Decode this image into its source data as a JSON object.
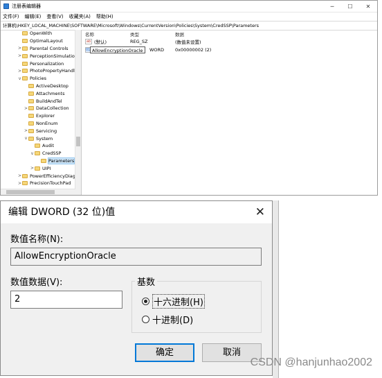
{
  "regedit": {
    "title": "注册表编辑器",
    "window_buttons": [
      "─",
      "☐",
      "✕"
    ],
    "menu": [
      "文件(F)",
      "编辑(E)",
      "查看(V)",
      "收藏夹(A)",
      "帮助(H)"
    ],
    "address": "计算机\\HKEY_LOCAL_MACHINE\\SOFTWARE\\Microsoft\\Windows\\CurrentVersion\\Policies\\System\\CredSSP\\Parameters",
    "tree": [
      {
        "label": "OpenWith",
        "depth": 0,
        "expander": ""
      },
      {
        "label": "OptimalLayout",
        "depth": 0,
        "expander": ""
      },
      {
        "label": "Parental Controls",
        "depth": 0,
        "expander": ">"
      },
      {
        "label": "PerceptionSimulatio",
        "depth": 0,
        "expander": ">"
      },
      {
        "label": "Personalization",
        "depth": 0,
        "expander": ""
      },
      {
        "label": "PhotoPropertyHandl",
        "depth": 0,
        "expander": ">"
      },
      {
        "label": "Policies",
        "depth": 0,
        "expander": "v"
      },
      {
        "label": "ActiveDesktop",
        "depth": 1,
        "expander": ""
      },
      {
        "label": "Attachments",
        "depth": 1,
        "expander": ""
      },
      {
        "label": "BuildAndTel",
        "depth": 1,
        "expander": ""
      },
      {
        "label": "DataCollection",
        "depth": 1,
        "expander": ">"
      },
      {
        "label": "Explorer",
        "depth": 1,
        "expander": ""
      },
      {
        "label": "NonEnum",
        "depth": 1,
        "expander": ""
      },
      {
        "label": "Servicing",
        "depth": 1,
        "expander": ">"
      },
      {
        "label": "System",
        "depth": 1,
        "expander": "v"
      },
      {
        "label": "Audit",
        "depth": 2,
        "expander": ""
      },
      {
        "label": "CredSSP",
        "depth": 2,
        "expander": "v"
      },
      {
        "label": "Parameters",
        "depth": 3,
        "expander": "",
        "selected": true
      },
      {
        "label": "UIPI",
        "depth": 2,
        "expander": ">"
      },
      {
        "label": "PowerEfficiencyDiagr",
        "depth": 0,
        "expander": ">"
      },
      {
        "label": "PrecisionTouchPad",
        "depth": 0,
        "expander": ">"
      }
    ],
    "columns": {
      "name": "名称",
      "type": "类型",
      "data": "数据"
    },
    "values": [
      {
        "icon": "ab",
        "name": "(默认)",
        "type": "REG_SZ",
        "data": "(数值未设置)"
      },
      {
        "icon": "011",
        "name": "AllowEncryptionOracle",
        "type": "WORD",
        "data": "0x00000002 (2)",
        "renaming": true
      }
    ]
  },
  "dialog": {
    "title": "编辑 DWORD (32 位)值",
    "close_glyph": "✕",
    "name_label": "数值名称(N):",
    "name_value": "AllowEncryptionOracle",
    "data_label": "数值数据(V):",
    "data_value": "2",
    "base_label": "基数",
    "hex_label": "十六进制(H)",
    "dec_label": "十进制(D)",
    "base_selected": "hex",
    "ok_label": "确定",
    "cancel_label": "取消"
  },
  "watermark": "CSDN @hanjunhao2002",
  "colors": {
    "accent": "#0078d7",
    "selection": "#cce4f7",
    "dialog_bg": "#f0f0f0"
  }
}
